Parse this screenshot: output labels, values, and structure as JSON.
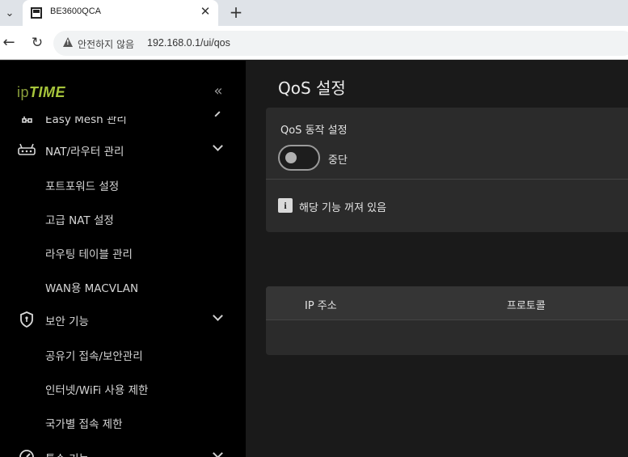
{
  "browser": {
    "tab_title": "BE3600QCA",
    "security_label": "안전하지 않음",
    "url": "192.168.0.1/ui/qos"
  },
  "sidebar": {
    "logo_ip": "ip",
    "logo_time": "TIME",
    "menu": [
      {
        "label": "Easy Mesh 관리",
        "icon": "mesh-icon"
      },
      {
        "label": "NAT/라우터 관리",
        "icon": "router-icon",
        "expanded": true,
        "children": [
          "포트포워드 설정",
          "고급 NAT 설정",
          "라우팅 테이블 관리",
          "WAN용 MACVLAN"
        ]
      },
      {
        "label": "보안 기능",
        "icon": "shield-icon",
        "expanded": true,
        "children": [
          "공유기 접속/보안관리",
          "인터넷/WiFi 사용 제한",
          "국가별 접속 제한"
        ]
      },
      {
        "label": "특수 기능",
        "icon": "gauge-icon"
      }
    ]
  },
  "main": {
    "title": "QoS 설정",
    "qos_setting_label": "QoS 동작 설정",
    "toggle_state": "중단",
    "toggle_on": false,
    "info_text": "해당 기능 꺼져 있음",
    "table_headers": [
      "IP 주소",
      "프로토콜"
    ]
  },
  "colors": {
    "sidebar_bg": "#000000",
    "main_bg": "#1a1a1a",
    "card_bg": "#2b2b2b",
    "logo_green": "#a6c43b"
  }
}
